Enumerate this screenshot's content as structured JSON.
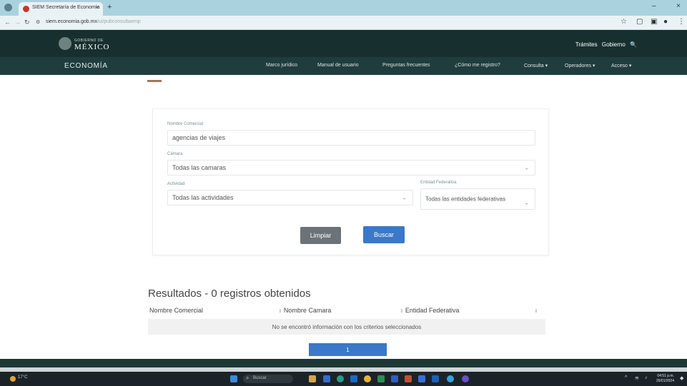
{
  "browser": {
    "tab_title": "SIEM Secretaría de Economía",
    "tab_close": "×",
    "new_tab": "+",
    "url_host": "siem.economia.gob.mx",
    "url_path": "/ui/pubconsultaemp",
    "window_min": "–",
    "window_close": "×"
  },
  "header": {
    "logo_sub": "GOBIERNO DE",
    "logo_main": "MÉXICO",
    "top_links": [
      "Trámites",
      "Gobierno",
      "🔍"
    ],
    "brand": "ECONOMÍA",
    "nav": [
      "Marco jurídico",
      "Manual de usuario",
      "Preguntas frecuentes",
      "¿Cómo me registro?",
      "Consulta ▾",
      "Operadores ▾",
      "Acceso ▾"
    ]
  },
  "form": {
    "nombre_label": "Nombre Comercial",
    "nombre_value": "agencias de viajes",
    "camara_label": "Cámara",
    "camara_value": "Todas las camaras",
    "actividad_label": "Actividad",
    "actividad_value": "Todas las actividades",
    "entidad_label": "Entidad Federativa",
    "entidad_value": "Todas las entidades federativas",
    "limpiar": "Limpiar",
    "buscar": "Buscar"
  },
  "results": {
    "title": "Resultados - 0 registros obtenidos",
    "columns": [
      "Nombre Comercial",
      "Nombre Camara",
      "Entidad Federativa"
    ],
    "empty_message": "No se encontró información con los criterios seleccionados",
    "page": "1"
  },
  "taskbar": {
    "weather": "17°C",
    "search_placeholder": "Buscar",
    "clock_time": "04:51 p.m.",
    "clock_date": "26/01/2024"
  },
  "colors": {
    "header_dark": "#17302f",
    "accent_blue": "#3a78c9",
    "button_gray": "#6c7378"
  }
}
